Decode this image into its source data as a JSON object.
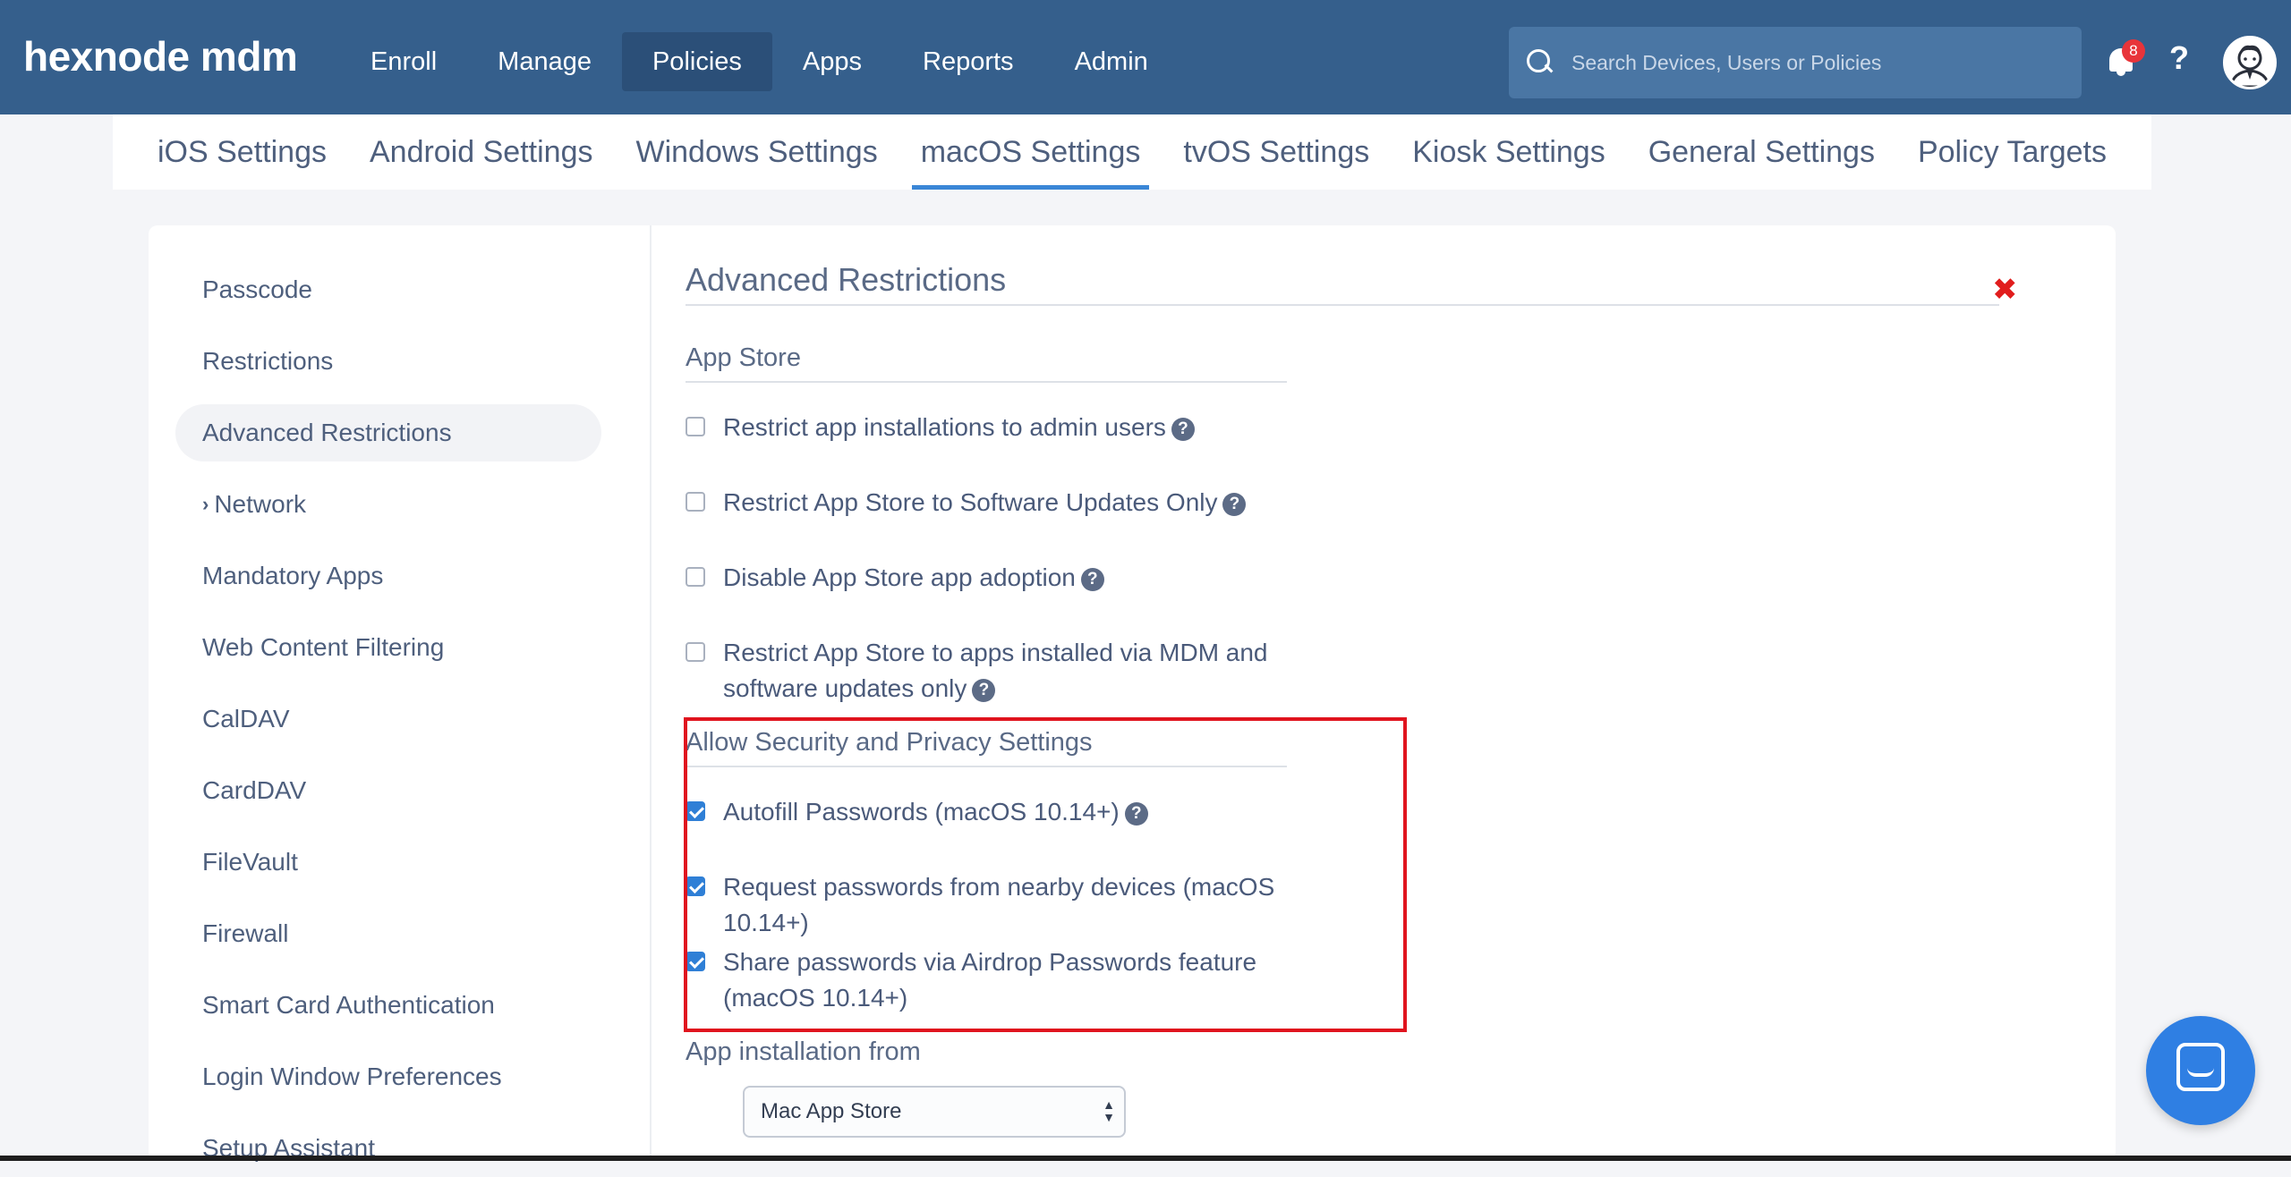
{
  "brand": {
    "logo": "hexnode mdm"
  },
  "nav": {
    "items": [
      {
        "label": "Enroll",
        "active": false
      },
      {
        "label": "Manage",
        "active": false
      },
      {
        "label": "Policies",
        "active": true
      },
      {
        "label": "Apps",
        "active": false
      },
      {
        "label": "Reports",
        "active": false
      },
      {
        "label": "Admin",
        "active": false
      }
    ]
  },
  "search": {
    "placeholder": "Search Devices, Users or Policies"
  },
  "notifications": {
    "count": "8"
  },
  "help_label": "?",
  "tabs": [
    {
      "label": "iOS Settings",
      "active": false
    },
    {
      "label": "Android Settings",
      "active": false
    },
    {
      "label": "Windows Settings",
      "active": false
    },
    {
      "label": "macOS Settings",
      "active": true
    },
    {
      "label": "tvOS Settings",
      "active": false
    },
    {
      "label": "Kiosk Settings",
      "active": false
    },
    {
      "label": "General Settings",
      "active": false
    },
    {
      "label": "Policy Targets",
      "active": false
    }
  ],
  "sidebar": {
    "items": [
      {
        "label": "Passcode"
      },
      {
        "label": "Restrictions"
      },
      {
        "label": "Advanced Restrictions",
        "active": true
      },
      {
        "label": "Network",
        "expandable": true
      },
      {
        "label": "Mandatory Apps"
      },
      {
        "label": "Web Content Filtering"
      },
      {
        "label": "CalDAV"
      },
      {
        "label": "CardDAV"
      },
      {
        "label": "FileVault"
      },
      {
        "label": "Firewall"
      },
      {
        "label": "Smart Card Authentication"
      },
      {
        "label": "Login Window Preferences"
      },
      {
        "label": "Setup Assistant"
      }
    ]
  },
  "main": {
    "title": "Advanced Restrictions",
    "close_symbol": "✖",
    "sections": {
      "app_store": {
        "title": "App Store",
        "options": [
          {
            "label": "Restrict app installations to admin users",
            "checked": false
          },
          {
            "label": "Restrict App Store to Software Updates Only",
            "checked": false
          },
          {
            "label": "Disable App Store app adoption",
            "checked": false
          },
          {
            "label": "Restrict App Store to apps installed via MDM and software updates only",
            "checked": false
          }
        ]
      },
      "security": {
        "title": "Allow Security and Privacy Settings",
        "options": [
          {
            "label": "Autofill Passwords (macOS 10.14+)",
            "checked": true
          },
          {
            "label": "Request passwords from nearby devices (macOS 10.14+)",
            "checked": true
          },
          {
            "label": "Share passwords via Airdrop Passwords feature (macOS 10.14+)",
            "checked": true
          }
        ]
      },
      "install": {
        "title": "App installation from",
        "selected": "Mac App Store"
      }
    }
  },
  "colors": {
    "navbar": "#355f8c",
    "nav_active": "#2b4f78",
    "tab_underline": "#3a86d6",
    "checkbox_checked": "#2f7fd6",
    "highlight_border": "#e0141e",
    "close": "#e11d1d",
    "chat_button": "#2f7fe3"
  },
  "icons": {
    "search": "search-icon",
    "notifications": "bell-icon",
    "help": "question-icon",
    "avatar": "avatar-icon",
    "close": "close-icon",
    "chat": "chat-icon",
    "tooltip": "help-circle-icon",
    "expand": "chevron-right-icon"
  }
}
